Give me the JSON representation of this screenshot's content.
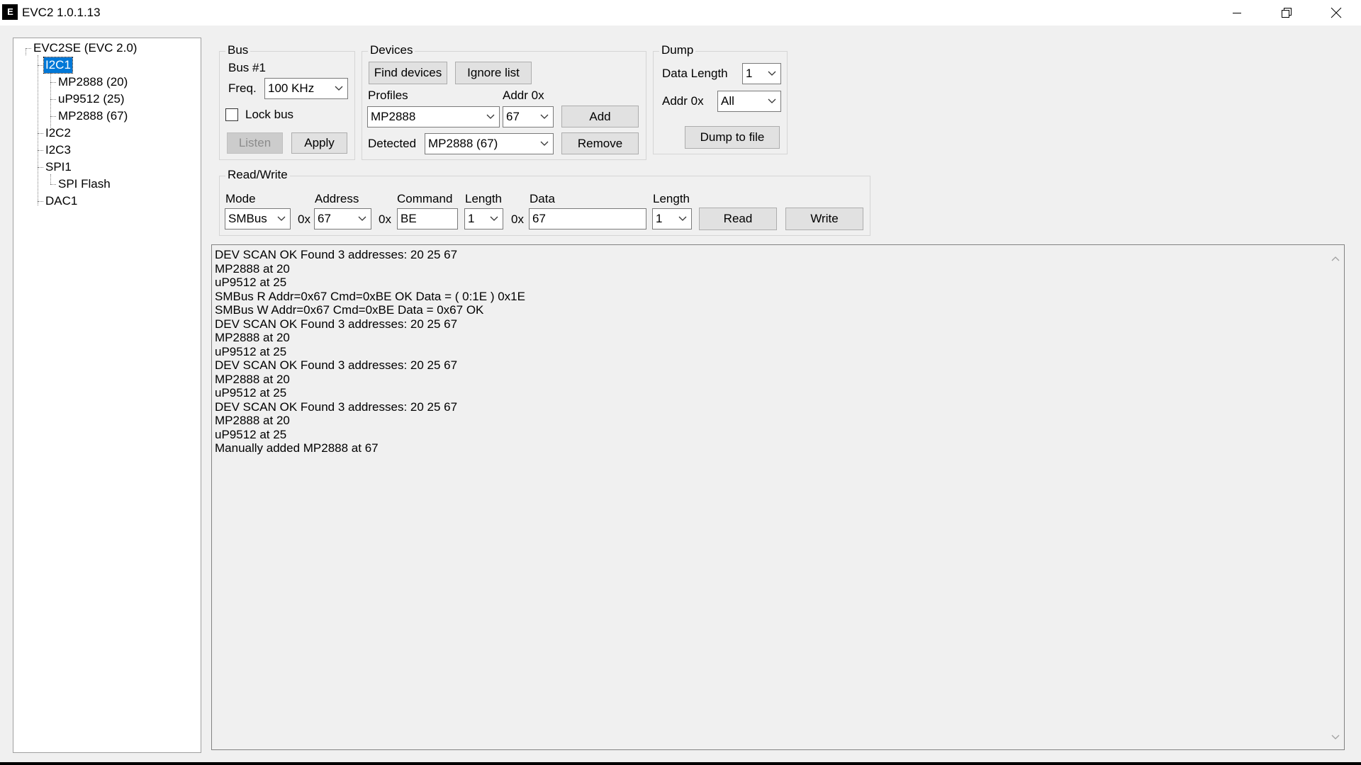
{
  "window": {
    "title": "EVC2 1.0.1.13",
    "icon_text": "E"
  },
  "tree": {
    "root": "EVC2SE (EVC 2.0)",
    "nodes": [
      {
        "label": "I2C1",
        "selected": true
      },
      {
        "label": "MP2888 (20)"
      },
      {
        "label": "uP9512 (25)"
      },
      {
        "label": "MP2888 (67)"
      },
      {
        "label": "I2C2"
      },
      {
        "label": "I2C3"
      },
      {
        "label": "SPI1"
      },
      {
        "label": "SPI Flash"
      },
      {
        "label": "DAC1"
      }
    ]
  },
  "bus": {
    "title": "Bus",
    "bus_number": "Bus #1",
    "freq_label": "Freq.",
    "freq_value": "100 KHz",
    "lock_label": "Lock bus",
    "lock_checked": false,
    "listen_label": "Listen",
    "apply_label": "Apply"
  },
  "devices": {
    "title": "Devices",
    "find_label": "Find devices",
    "ignore_label": "Ignore list",
    "profiles_label": "Profiles",
    "addr_label": "Addr 0x",
    "profile_value": "MP2888",
    "addr_value": "67",
    "add_label": "Add",
    "detected_label": "Detected",
    "detected_value": "MP2888 (67)",
    "remove_label": "Remove"
  },
  "dump": {
    "title": "Dump",
    "data_length_label": "Data Length",
    "data_length_value": "1",
    "addr_label": "Addr 0x",
    "addr_value": "All",
    "dump_label": "Dump to file"
  },
  "readwrite": {
    "title": "Read/Write",
    "mode_label": "Mode",
    "mode_value": "SMBus",
    "prefix_0x": "0x",
    "address_label": "Address",
    "address_value": "67",
    "command_label": "Command",
    "command_value": "BE",
    "length_label": "Length",
    "length_value": "1",
    "data_label": "Data",
    "data_value": "67",
    "length2_label": "Length",
    "length2_value": "1",
    "read_label": "Read",
    "write_label": "Write"
  },
  "log": {
    "lines": [
      "DEV SCAN OK Found 3 addresses: 20 25 67",
      "MP2888 at 20",
      "uP9512 at 25",
      "SMBus R Addr=0x67 Cmd=0xBE OK Data = ( 0:1E ) 0x1E",
      "SMBus W Addr=0x67 Cmd=0xBE Data = 0x67 OK",
      "DEV SCAN OK Found 3 addresses: 20 25 67",
      "MP2888 at 20",
      "uP9512 at 25",
      "DEV SCAN OK Found 3 addresses: 20 25 67",
      "MP2888 at 20",
      "uP9512 at 25",
      "DEV SCAN OK Found 3 addresses: 20 25 67",
      "MP2888 at 20",
      "uP9512 at 25",
      "Manually added MP2888 at 67"
    ]
  }
}
